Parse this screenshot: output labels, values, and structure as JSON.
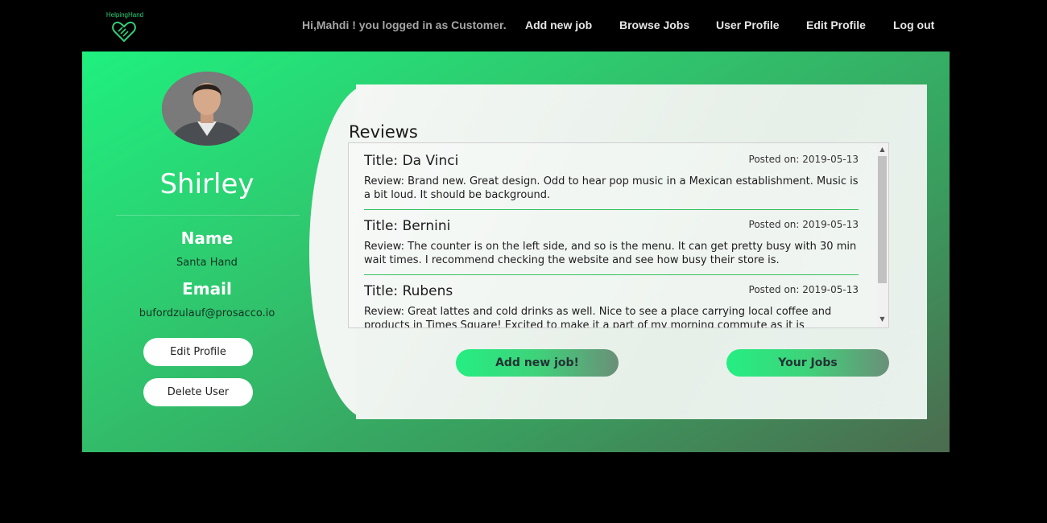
{
  "nav": {
    "logo_text": "HelpingHand",
    "greeting": "Hi,Mahdi ! you logged in as Customer.",
    "links": [
      "Add new job",
      "Browse Jobs",
      "User Profile",
      "Edit Profile",
      "Log out"
    ]
  },
  "profile": {
    "display_name": "Shirley",
    "name_label": "Name",
    "name_value": "Santa Hand",
    "email_label": "Email",
    "email_value": "bufordzulauf@prosacco.io",
    "edit_button": "Edit Profile",
    "delete_button": "Delete User"
  },
  "reviews": {
    "heading": "Reviews",
    "items": [
      {
        "title": "Title: Da Vinci",
        "date": "Posted on: 2019-05-13",
        "text": "Review: Brand new. Great design. Odd to hear pop music in a Mexican establishment. Music is a bit loud. It should be background."
      },
      {
        "title": "Title: Bernini",
        "date": "Posted on: 2019-05-13",
        "text": "Review: The counter is on the left side, and so is the menu. It can get pretty busy with 30 min wait times. I recommend checking the website and see how busy their store is."
      },
      {
        "title": "Title: Rubens",
        "date": "Posted on: 2019-05-13",
        "text": "Review: Great lattes and cold drinks as well. Nice to see a place carrying local coffee and products in Times Square! Excited to make it a part of my morning commute as it is"
      }
    ]
  },
  "actions": {
    "add_job": "Add new job!",
    "your_jobs": "Your Jobs"
  },
  "colors": {
    "accent": "#25ee82",
    "separator": "#38c05f"
  }
}
